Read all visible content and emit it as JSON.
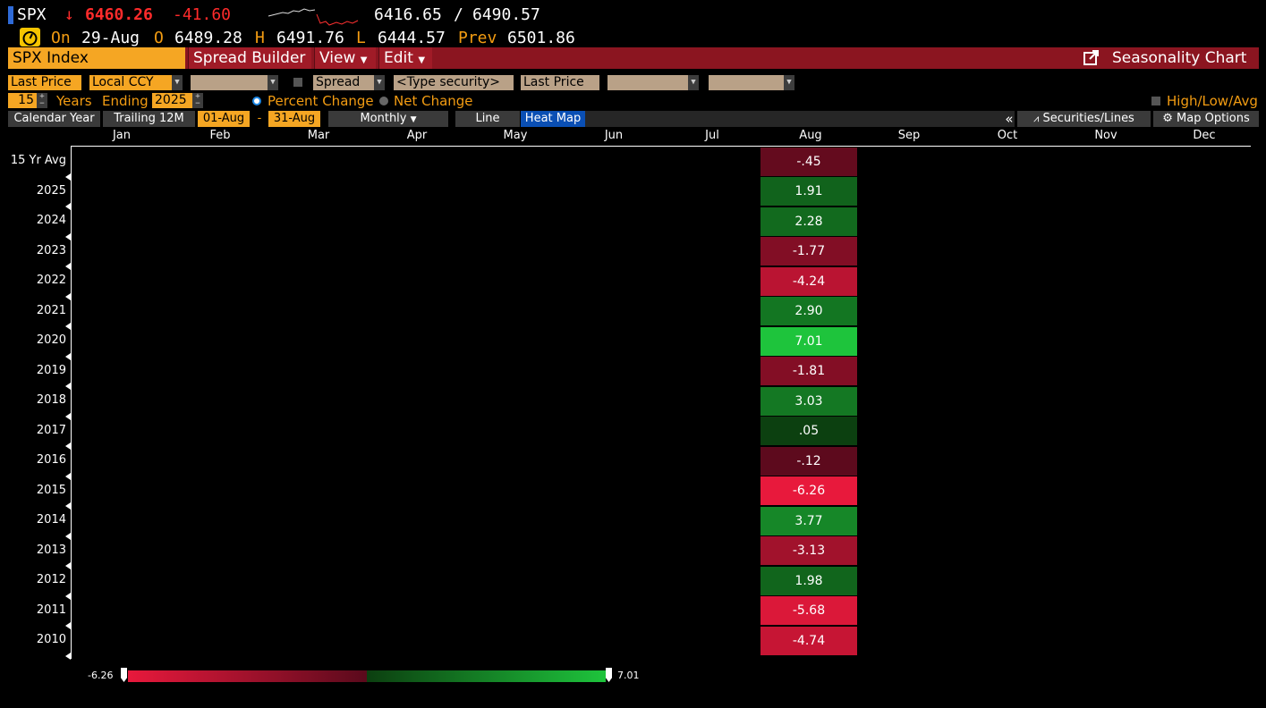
{
  "quote": {
    "ticker": "SPX",
    "arrow": "↓",
    "last": "6460.26",
    "change": "-41.60",
    "range_low": "6416.65",
    "range_sep": "/",
    "range_high": "6490.57",
    "on_label": "On",
    "date": "29-Aug",
    "open_label": "O",
    "open": "6489.28",
    "high_label": "H",
    "high": "6491.76",
    "low_label": "L",
    "low": "6444.57",
    "prev_label": "Prev",
    "prev": "6501.86"
  },
  "toolbar": {
    "security": "SPX Index",
    "spread_builder": "Spread Builder",
    "view": "View",
    "edit": "Edit",
    "title": "Seasonality Chart"
  },
  "controls": {
    "field": "Last Price",
    "currency": "Local CCY",
    "spread": "Spread",
    "type_security": "<Type security>",
    "field2": "Last Price",
    "years": "15",
    "years_label": "Years",
    "ending_label": "Ending",
    "ending_year": "2025",
    "percent_change": "Percent Change",
    "net_change": "Net Change",
    "high_low_avg": "High/Low/Avg",
    "calendar_year": "Calendar Year",
    "trailing": "Trailing 12M",
    "date_from": "01-Aug",
    "date_dash": "-",
    "date_to": "31-Aug",
    "period": "Monthly",
    "line": "Line",
    "heat_map": "Heat Map",
    "collapse": "«",
    "securities_lines": "Securities/Lines",
    "map_options": "Map Options"
  },
  "chart_data": {
    "type": "heatmap",
    "columns": [
      "Jan",
      "Feb",
      "Mar",
      "Apr",
      "May",
      "Jun",
      "Jul",
      "Aug",
      "Sep",
      "Oct",
      "Nov",
      "Dec"
    ],
    "rows": [
      "15 Yr Avg",
      "2025",
      "2024",
      "2023",
      "2022",
      "2021",
      "2020",
      "2019",
      "2018",
      "2017",
      "2016",
      "2015",
      "2014",
      "2013",
      "2012",
      "2011",
      "2010"
    ],
    "filled_column": "Aug",
    "values": [
      "-.45",
      "1.91",
      "2.28",
      "-1.77",
      "-4.24",
      "2.90",
      "7.01",
      "-1.81",
      "3.03",
      ".05",
      "-.12",
      "-6.26",
      "3.77",
      "-3.13",
      "1.98",
      "-5.68",
      "-4.74"
    ],
    "scale_min": "-6.26",
    "scale_max": "7.01",
    "colors": {
      "neg_max": "#e8193c",
      "neg_min": "#5a0a1c",
      "pos_min": "#0c3f10",
      "pos_max": "#1ec43c"
    }
  }
}
